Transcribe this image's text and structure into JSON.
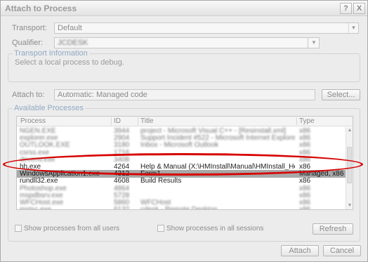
{
  "window": {
    "title": "Attach to Process"
  },
  "titlebar": {
    "help_glyph": "?",
    "close_glyph": "X"
  },
  "transport": {
    "label": "Transport:",
    "value": "Default"
  },
  "qualifier": {
    "label": "Qualifier:",
    "value": "JCDESK"
  },
  "transport_info": {
    "title": "Transport Information",
    "text": "Select a local process to debug."
  },
  "attach_to": {
    "label": "Attach to:",
    "value": "Automatic: Managed code",
    "select_button": "Select..."
  },
  "available": {
    "title": "Available Processes"
  },
  "columns": {
    "process": "Process",
    "id": "ID",
    "title": "Title",
    "type": "Type"
  },
  "rows": [
    {
      "process": "NGEN.EXE",
      "id": "3944",
      "title": "project - Microsoft Visual C++ - [Resinstall.xml]",
      "type": "x86",
      "blur": true
    },
    {
      "process": "explorer.exe",
      "id": "2904",
      "title": "Support Incident #522 - Microsoft Internet Explorer",
      "type": "x86",
      "blur": true
    },
    {
      "process": "OUTLOOK.EXE",
      "id": "3180",
      "title": "Inbox - Microsoft Outlook",
      "type": "x86",
      "blur": true
    },
    {
      "process": "csrss.exe",
      "id": "1716",
      "title": "",
      "type": "x86",
      "blur": true
    },
    {
      "process": "devenv.exe",
      "id": "3408",
      "title": "",
      "type": "x86",
      "blur": true
    },
    {
      "process": "hh.exe",
      "id": "4264",
      "title": "Help & Manual (X:\\HMInstall\\Manual\\HMInstall_Help.hmx)",
      "type": "x86",
      "blur": false
    },
    {
      "process": "WindowsApplication1.exe",
      "id": "4312",
      "title": "Form1",
      "type": "Managed, x86",
      "blur": false,
      "selected": true
    },
    {
      "process": "rundll32.exe",
      "id": "4608",
      "title": "Build Results",
      "type": "x86",
      "blur": false
    },
    {
      "process": "Photoshop.exe",
      "id": "4864",
      "title": "",
      "type": "x86",
      "blur": true
    },
    {
      "process": "mspdbsrv.exe",
      "id": "5728",
      "title": "",
      "type": "x86",
      "blur": true
    },
    {
      "process": "WFCHost.exe",
      "id": "5860",
      "title": "WFCHost",
      "type": "x86",
      "blur": true
    },
    {
      "process": "mstsc.exe",
      "id": "6132",
      "title": "cdesk - Remote Desktop",
      "type": "x86",
      "blur": true
    }
  ],
  "options": {
    "all_users": "Show processes from all users",
    "all_sessions": "Show processes in all sessions",
    "refresh": "Refresh"
  },
  "footer": {
    "attach": "Attach",
    "cancel": "Cancel"
  },
  "colors": {
    "highlight": "#d60000",
    "selected_row": "#a8a8a8"
  }
}
